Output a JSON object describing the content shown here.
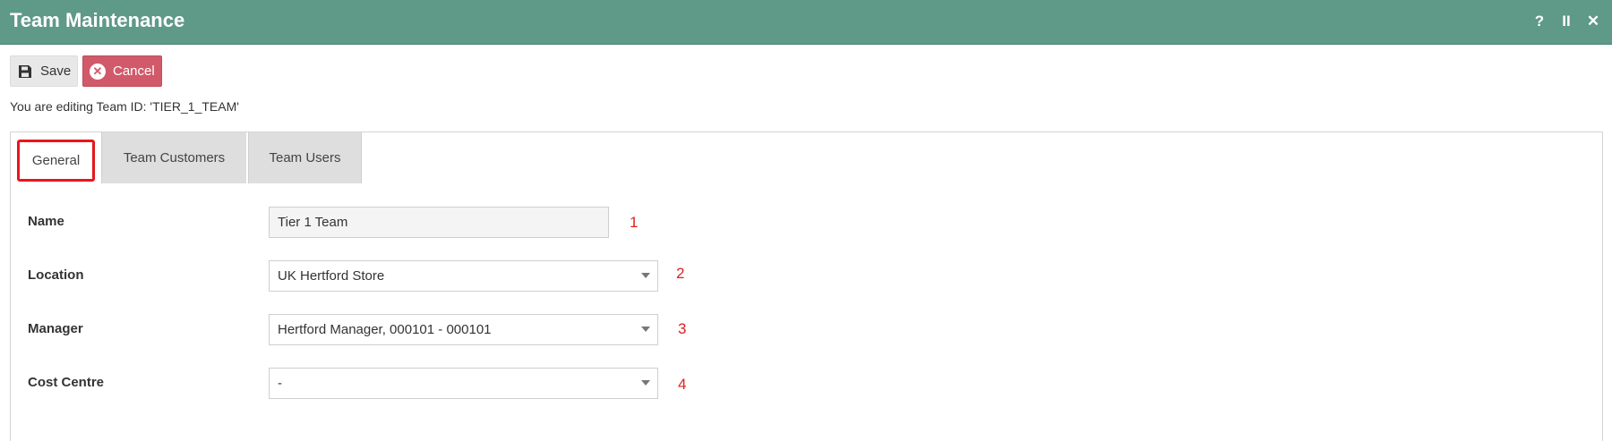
{
  "window": {
    "title": "Team Maintenance",
    "icons": [
      "help-icon",
      "pause-icon",
      "close-icon"
    ],
    "icon_glyphs": {
      "help": "?",
      "pause": "II",
      "close": "✕"
    }
  },
  "toolbar": {
    "save_label": "Save",
    "cancel_label": "Cancel"
  },
  "edit_info": "You are editing Team ID: 'TIER_1_TEAM'",
  "tabs": [
    {
      "label": "General",
      "active": true
    },
    {
      "label": "Team Customers",
      "active": false
    },
    {
      "label": "Team Users",
      "active": false
    }
  ],
  "form": {
    "name": {
      "label": "Name",
      "value": "Tier 1 Team",
      "annotation": "1"
    },
    "location": {
      "label": "Location",
      "value": "UK Hertford Store",
      "annotation": "2"
    },
    "manager": {
      "label": "Manager",
      "value": "Hertford Manager, 000101 - 000101",
      "annotation": "3"
    },
    "cost_centre": {
      "label": "Cost Centre",
      "value": "-",
      "annotation": "4"
    }
  },
  "colors": {
    "header": "#5f9988",
    "cancel": "#d05a6a",
    "highlight": "#e8161b",
    "annotation": "#e02020"
  }
}
